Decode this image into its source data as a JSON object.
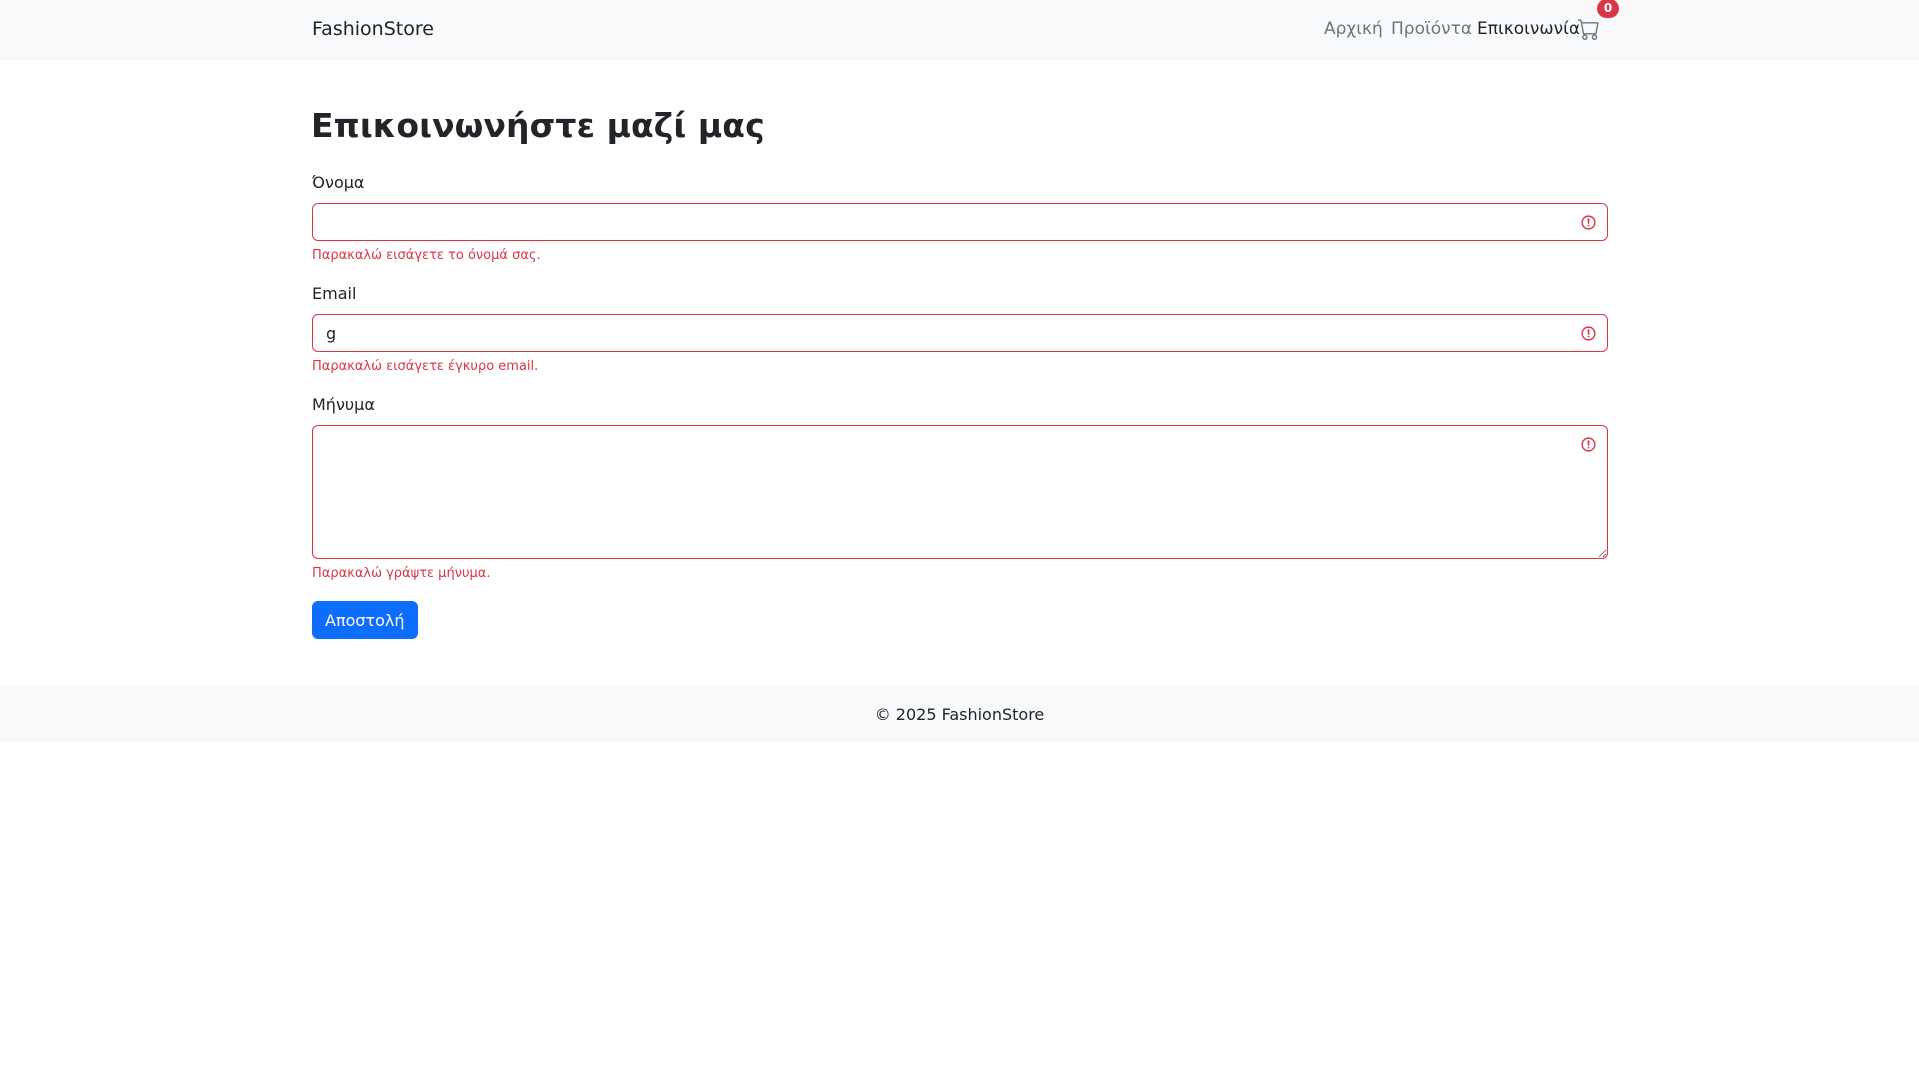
{
  "navbar": {
    "brand": "FashionStore",
    "links": [
      {
        "label": "Αρχική"
      },
      {
        "label": "Προϊόντα"
      },
      {
        "label": "Επικοινωνία",
        "active": true
      }
    ],
    "cart": {
      "icon": "cart-icon",
      "count": "0"
    }
  },
  "page": {
    "title": "Επικοινωνήστε μαζί μας"
  },
  "form": {
    "name": {
      "label": "Όνομα",
      "value": "",
      "error": "Παρακαλώ εισάγετε το όνομά σας.",
      "icon": "error-icon"
    },
    "email": {
      "label": "Email",
      "value": "g",
      "error": "Παρακαλώ εισάγετε έγκυρο email.",
      "icon": "error-icon"
    },
    "message": {
      "label": "Μήνυμα",
      "value": "",
      "error": "Παρακαλώ γράψτε μήνυμα.",
      "icon": "error-icon"
    },
    "submit_label": "Αποστολή"
  },
  "footer": {
    "text": "© 2025 FashionStore"
  },
  "colors": {
    "navbar_bg": "#f8f9fa",
    "danger": "#dc3545",
    "primary": "#0d6efd",
    "text": "#212529",
    "muted": "#6c757d"
  }
}
